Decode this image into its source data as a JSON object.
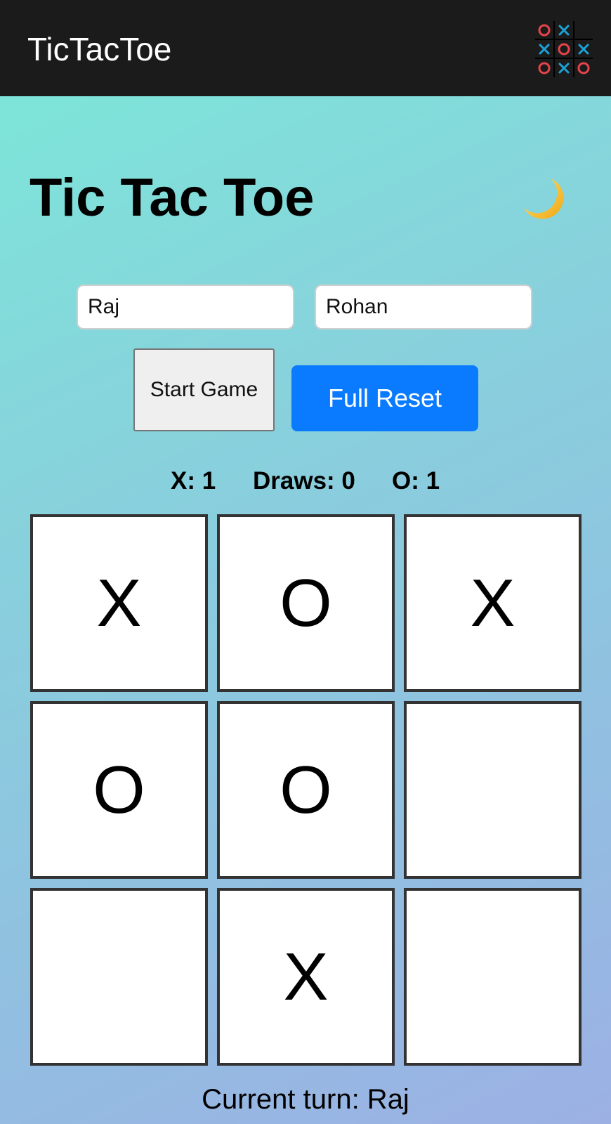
{
  "app_bar": {
    "title": "TicTacToe",
    "icon": "tic-tac-toe-grid-icon",
    "icon_colors": {
      "o": "#e8434b",
      "x": "#1aa3d9"
    }
  },
  "header": {
    "title": "Tic Tac Toe",
    "theme_toggle_icon": "moon-icon"
  },
  "players": {
    "player1_value": "Raj",
    "player2_value": "Rohan"
  },
  "controls": {
    "start_label": "Start Game",
    "reset_label": "Full Reset",
    "reset_color": "#0a7bff"
  },
  "scores": {
    "x": "X: 1",
    "draws": "Draws: 0",
    "o": "O: 1"
  },
  "board": {
    "cells": [
      "X",
      "O",
      "X",
      "O",
      "O",
      "",
      "",
      "X",
      ""
    ]
  },
  "status": {
    "turn_text": "Current turn: Raj"
  }
}
